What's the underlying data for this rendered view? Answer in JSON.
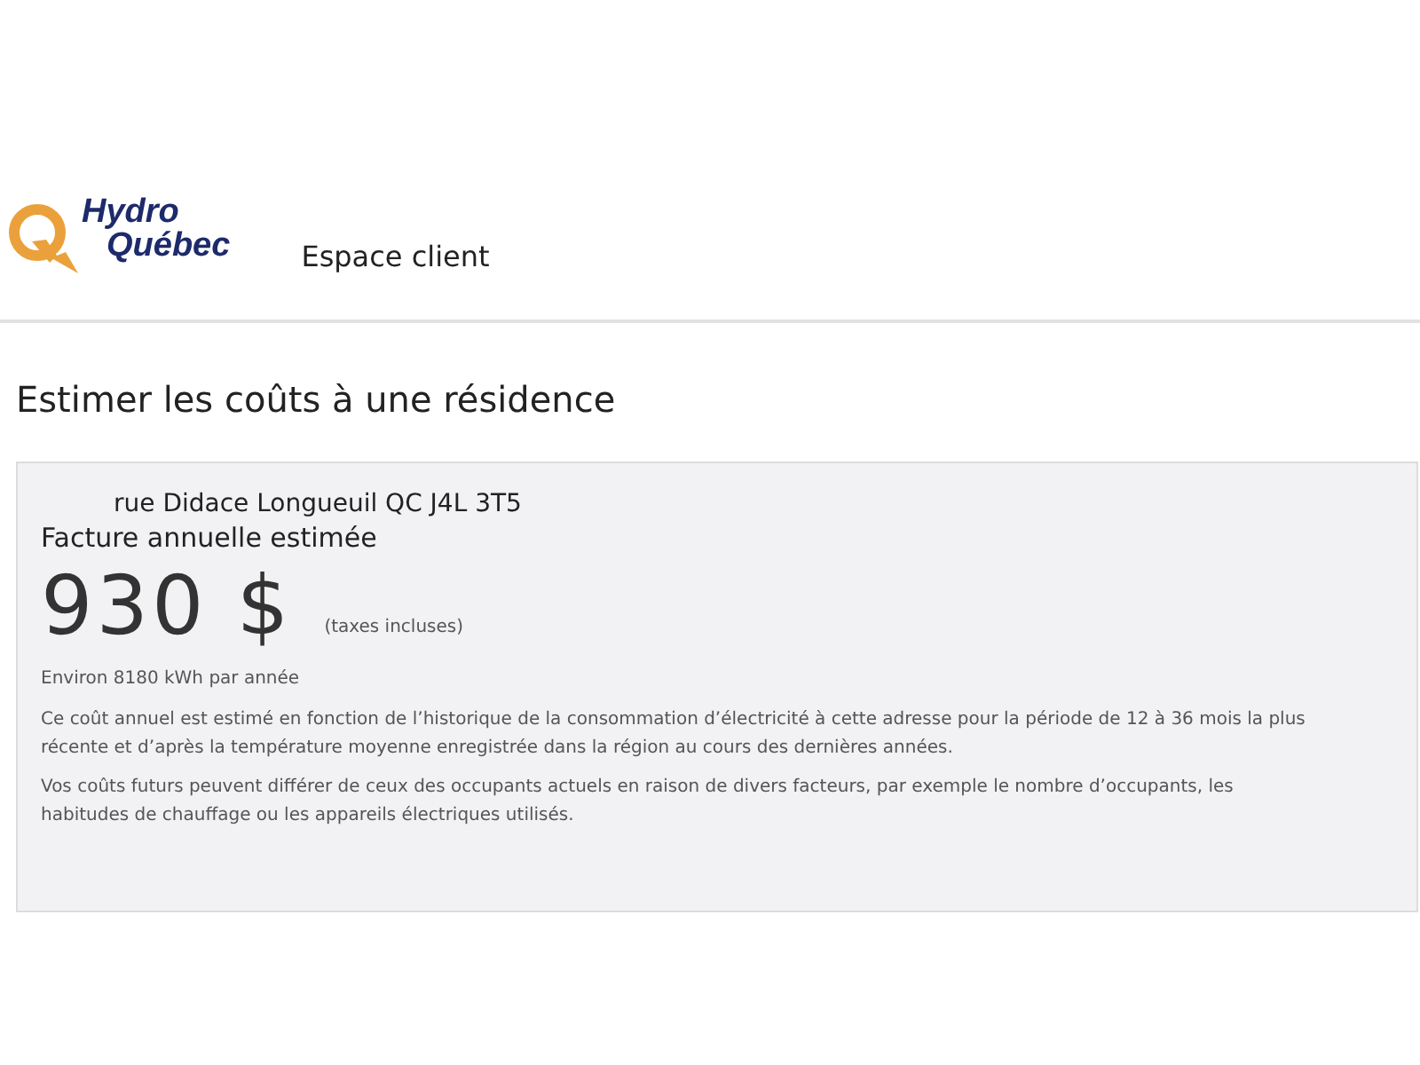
{
  "header": {
    "logo": [
      "Hydro",
      "Québec"
    ],
    "section": "Espace client"
  },
  "page_title": "Estimer les coûts à une résidence",
  "estimate": {
    "address": "rue Didace Longueuil QC J4L 3T5",
    "label": "Facture annuelle estimée",
    "amount": "930 $",
    "tax_note": "(taxes incluses)",
    "consumption": "Environ 8180 kWh par année",
    "notes": [
      "Ce coût annuel est estimé en fonction de l’historique de la consommation d’électricité à cette adresse pour la période de 12 à 36 mois la plus récente et d’après la température moyenne enregistrée dans la région au cours des dernières années.",
      "Vos coûts futurs peuvent différer de ceux des occupants actuels en raison de divers facteurs, par exemple le nombre d’occupants, les habitudes de chauffage ou les appareils électriques utilisés."
    ]
  }
}
